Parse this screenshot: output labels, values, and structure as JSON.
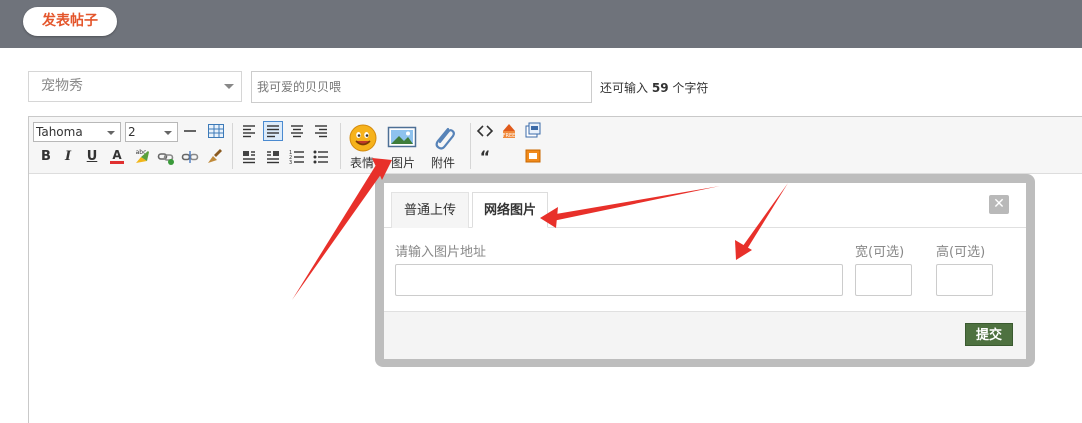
{
  "header": {
    "post_button": "发表帖子"
  },
  "form": {
    "category_value": "宠物秀",
    "title_value": "我可爱的贝贝喂",
    "remaining": {
      "prefix": "还可输入",
      "count": "59",
      "suffix": "个字符"
    }
  },
  "toolbar": {
    "font_value": "Tahoma",
    "size_value": "2",
    "emoji_label": "表情",
    "image_label": "图片",
    "attach_label": "附件",
    "quote_glyph": "“"
  },
  "dialog": {
    "tab_upload": "普通上传",
    "tab_network": "网络图片",
    "close_glyph": "✕",
    "url_label": "请输入图片地址",
    "width_label": "宽(可选)",
    "height_label": "高(可选)",
    "submit_label": "提交"
  },
  "colors": {
    "topbar": "#6f737b",
    "accent": "#e4562c",
    "submit": "#4e7140",
    "arrow": "#e8302a"
  }
}
